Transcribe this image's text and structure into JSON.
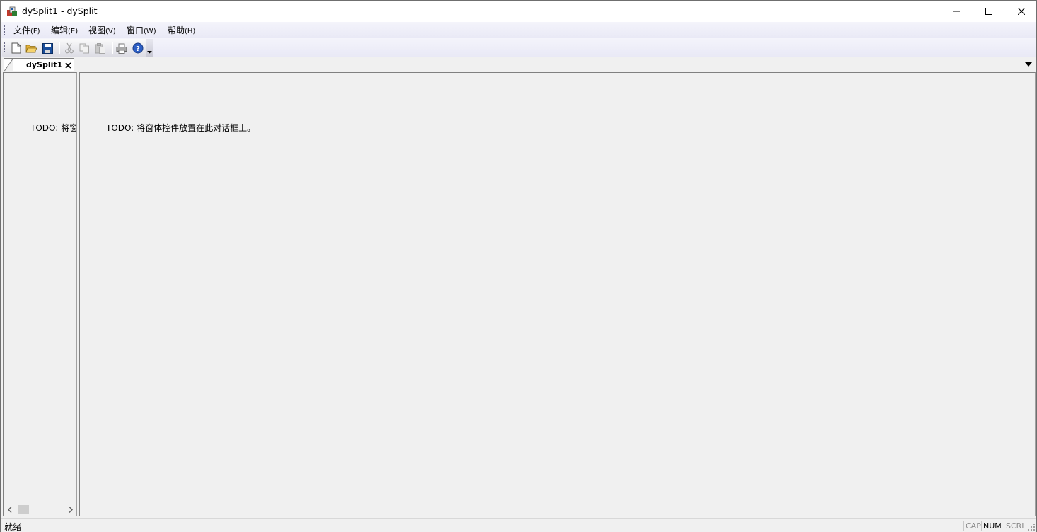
{
  "window": {
    "title": "dySplit1 - dySplit"
  },
  "menubar": {
    "items": [
      {
        "label": "文件",
        "accel": "(F)"
      },
      {
        "label": "编辑",
        "accel": "(E)"
      },
      {
        "label": "视图",
        "accel": "(V)"
      },
      {
        "label": "窗口",
        "accel": "(W)"
      },
      {
        "label": "帮助",
        "accel": "(H)"
      }
    ]
  },
  "toolbar": {
    "buttons": [
      "new-icon",
      "open-icon",
      "save-icon",
      "cut-icon",
      "copy-icon",
      "paste-icon",
      "print-icon",
      "help-icon"
    ],
    "disabled": [
      "cut-icon",
      "copy-icon",
      "paste-icon"
    ]
  },
  "tabs": [
    {
      "label": "dySplit1",
      "active": true
    }
  ],
  "panes": {
    "left_text": "TODO: 将窗",
    "right_text": "TODO: 将窗体控件放置在此对话框上。"
  },
  "statusbar": {
    "text": "就绪",
    "indicators": [
      {
        "label": "CAP",
        "active": false
      },
      {
        "label": "NUM",
        "active": true
      },
      {
        "label": "SCRL",
        "active": false
      }
    ]
  },
  "colors": {
    "menubar_bg": "#eeeef8",
    "pane_bg": "#f0f0f0",
    "help_blue": "#2d5fc4",
    "save_blue": "#1b4f9c",
    "folder_yellow": "#e8b43a"
  }
}
